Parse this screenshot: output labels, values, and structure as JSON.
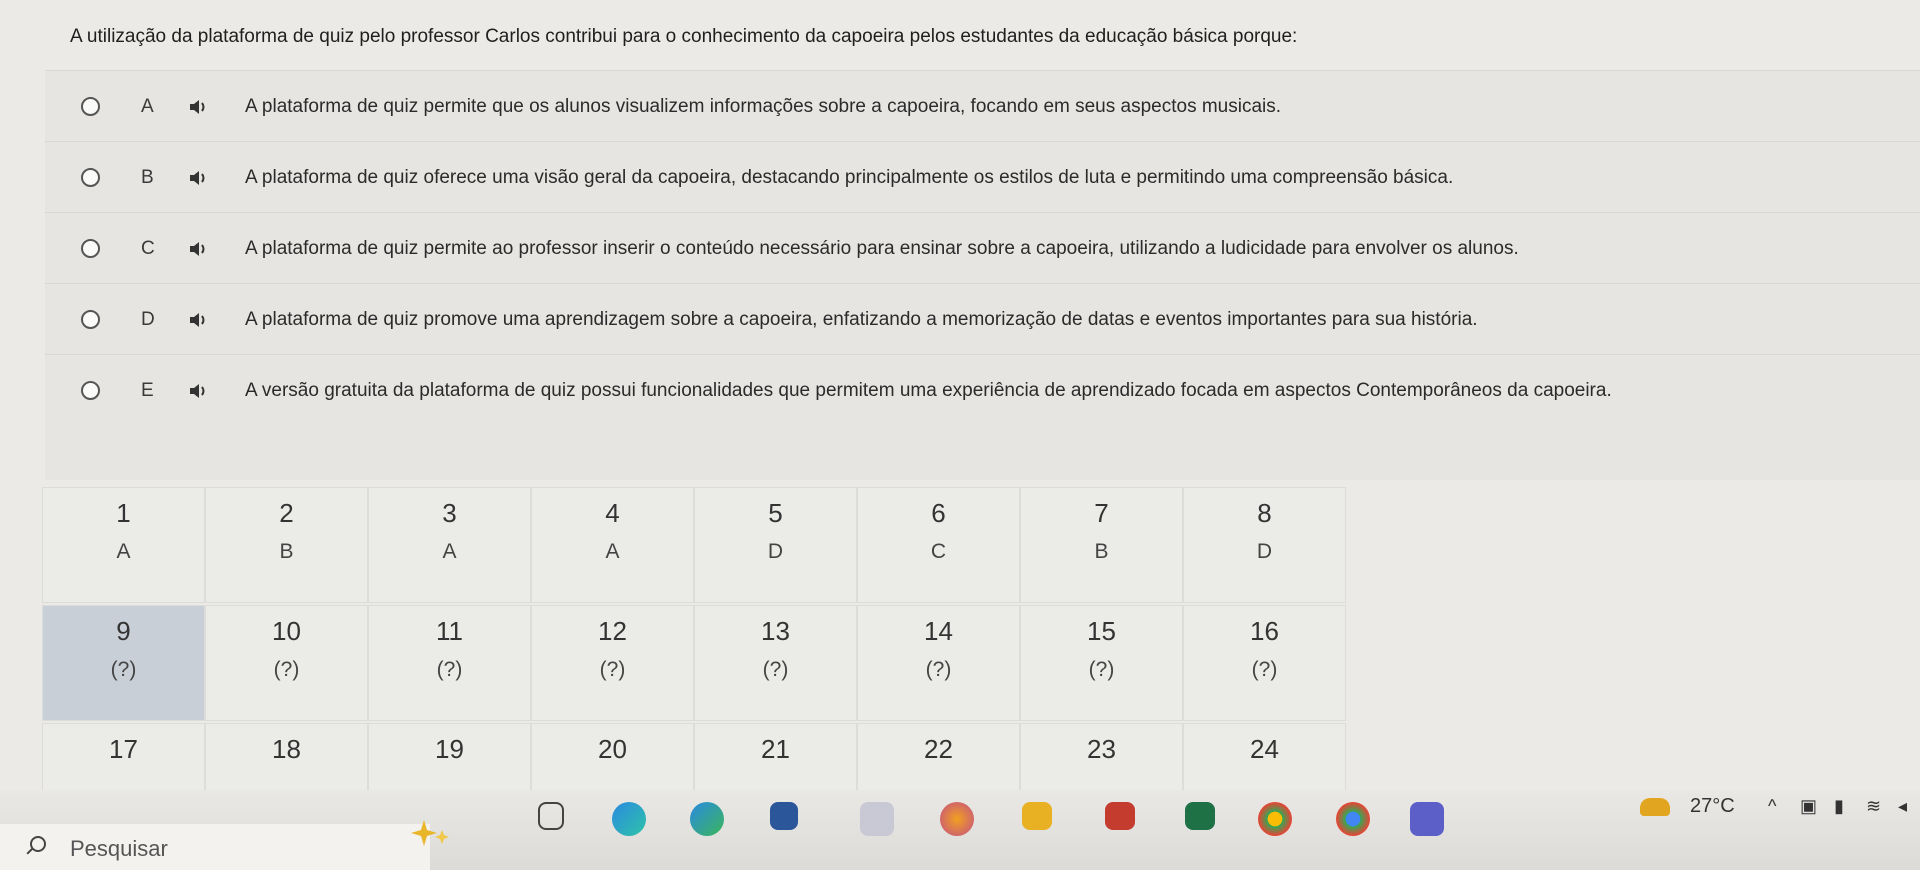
{
  "question": "A utilização da plataforma de quiz pelo professor Carlos contribui para o conhecimento da capoeira pelos estudantes da educação básica porque:",
  "options": [
    {
      "letter": "A",
      "text": "A plataforma de quiz permite que os alunos visualizem informações sobre a capoeira, focando em seus aspectos musicais."
    },
    {
      "letter": "B",
      "text": "A plataforma de quiz oferece uma visão geral da capoeira, destacando principalmente os estilos de luta e permitindo uma compreensão básica."
    },
    {
      "letter": "C",
      "text": "A plataforma de quiz permite ao professor inserir o conteúdo necessário para ensinar sobre a capoeira, utilizando a ludicidade para envolver os alunos."
    },
    {
      "letter": "D",
      "text": "A plataforma de quiz promove uma aprendizagem sobre a capoeira, enfatizando a memorização de datas e eventos importantes para sua história."
    },
    {
      "letter": "E",
      "text": "A versão gratuita da plataforma de quiz possui funcionalidades que permitem uma experiência de aprendizado focada em aspectos Contemporâneos da capoeira."
    }
  ],
  "grid": {
    "cells": [
      {
        "n": "1",
        "a": "A"
      },
      {
        "n": "2",
        "a": "B"
      },
      {
        "n": "3",
        "a": "A"
      },
      {
        "n": "4",
        "a": "A"
      },
      {
        "n": "5",
        "a": "D"
      },
      {
        "n": "6",
        "a": "C"
      },
      {
        "n": "7",
        "a": "B"
      },
      {
        "n": "8",
        "a": "D"
      },
      {
        "n": "9",
        "a": "(?)"
      },
      {
        "n": "10",
        "a": "(?)"
      },
      {
        "n": "11",
        "a": "(?)"
      },
      {
        "n": "12",
        "a": "(?)"
      },
      {
        "n": "13",
        "a": "(?)"
      },
      {
        "n": "14",
        "a": "(?)"
      },
      {
        "n": "15",
        "a": "(?)"
      },
      {
        "n": "16",
        "a": "(?)"
      },
      {
        "n": "17",
        "a": ""
      },
      {
        "n": "18",
        "a": ""
      },
      {
        "n": "19",
        "a": ""
      },
      {
        "n": "20",
        "a": ""
      },
      {
        "n": "21",
        "a": ""
      },
      {
        "n": "22",
        "a": ""
      },
      {
        "n": "23",
        "a": ""
      },
      {
        "n": "24",
        "a": ""
      }
    ],
    "active": "9"
  },
  "taskbar": {
    "search_placeholder": "Pesquisar",
    "temperature": "27°C",
    "accent": "#0a61c9"
  }
}
